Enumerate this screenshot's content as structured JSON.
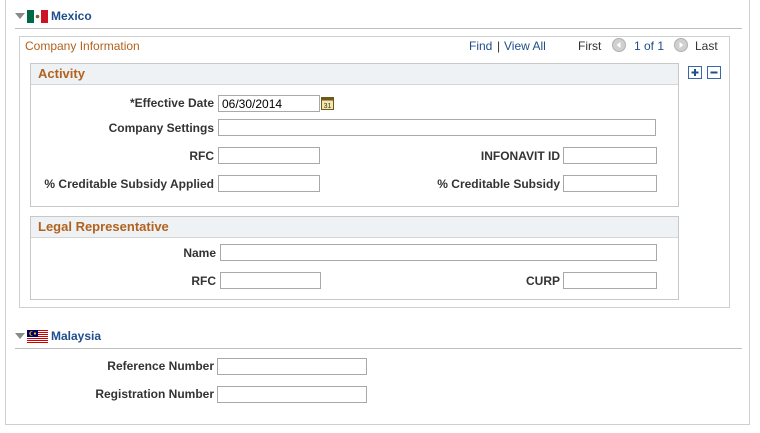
{
  "mexico": {
    "section_title": "Mexico",
    "company_info": {
      "title": "Company Information",
      "find": "Find",
      "separator": "|",
      "view_all": "View All",
      "first": "First",
      "range": "1 of 1",
      "last": "Last"
    },
    "activity": {
      "title": "Activity",
      "effective_date_label": "*Effective Date",
      "effective_date_value": "06/30/2014",
      "company_settings_label": "Company Settings",
      "rfc_label": "RFC",
      "infonavit_label": "INFONAVIT ID",
      "creditable_subsidy_applied_label": "% Creditable Subsidy Applied",
      "creditable_subsidy_label": "% Creditable Subsidy"
    },
    "legal_rep": {
      "title": "Legal Representative",
      "name_label": "Name",
      "rfc_label": "RFC",
      "curp_label": "CURP"
    }
  },
  "malaysia": {
    "section_title": "Malaysia",
    "reference_number_label": "Reference Number",
    "registration_number_label": "Registration Number"
  },
  "colors": {
    "link": "#1f4e8c",
    "box_title": "#b3621e",
    "box_header_bg": "#eef2f5"
  },
  "icons": {
    "calendar": "calendar-icon",
    "add": "plus-icon",
    "remove": "minus-icon"
  }
}
